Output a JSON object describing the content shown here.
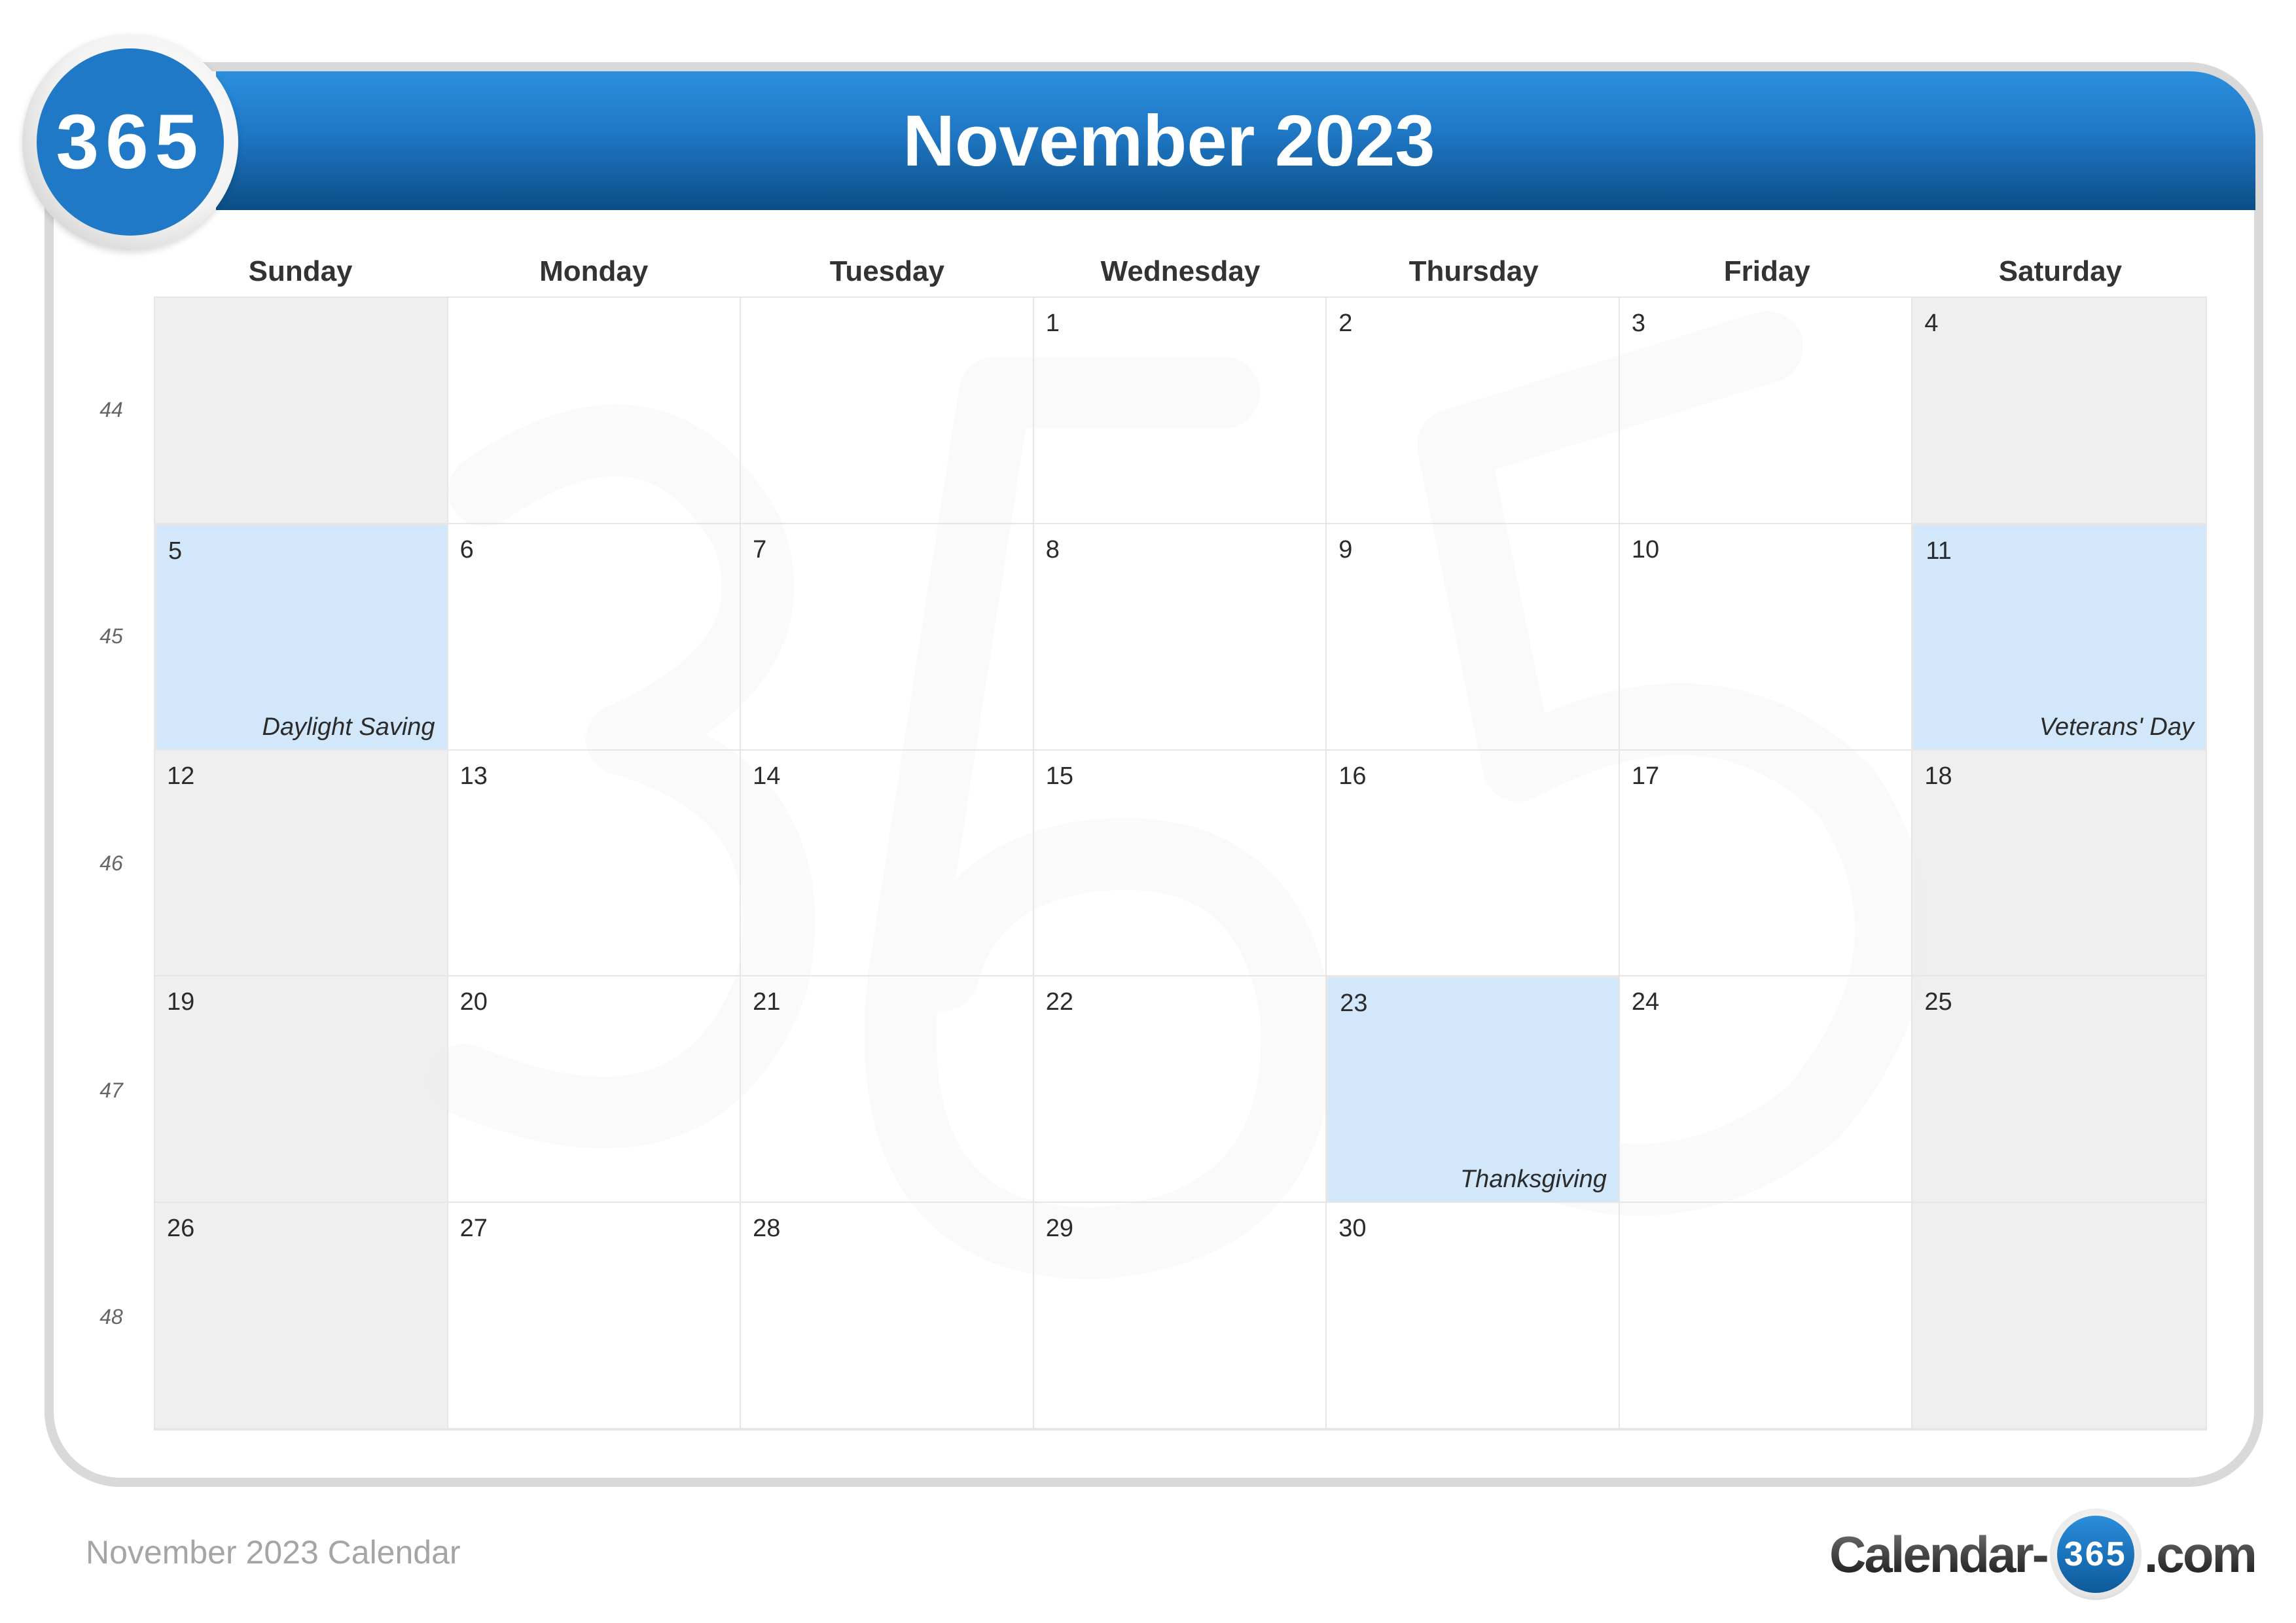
{
  "logo": {
    "text": "365"
  },
  "header": {
    "title": "November 2023"
  },
  "day_headers": [
    "Sunday",
    "Monday",
    "Tuesday",
    "Wednesday",
    "Thursday",
    "Friday",
    "Saturday"
  ],
  "week_numbers": [
    "44",
    "45",
    "46",
    "47",
    "48"
  ],
  "weeks": [
    [
      {
        "day": "",
        "weekend": true
      },
      {
        "day": ""
      },
      {
        "day": ""
      },
      {
        "day": "1"
      },
      {
        "day": "2"
      },
      {
        "day": "3"
      },
      {
        "day": "4",
        "weekend": true
      }
    ],
    [
      {
        "day": "5",
        "weekend": true,
        "holiday": true,
        "event": "Daylight Saving"
      },
      {
        "day": "6"
      },
      {
        "day": "7"
      },
      {
        "day": "8"
      },
      {
        "day": "9"
      },
      {
        "day": "10"
      },
      {
        "day": "11",
        "weekend": true,
        "holiday": true,
        "event": "Veterans' Day"
      }
    ],
    [
      {
        "day": "12",
        "weekend": true
      },
      {
        "day": "13"
      },
      {
        "day": "14"
      },
      {
        "day": "15"
      },
      {
        "day": "16"
      },
      {
        "day": "17"
      },
      {
        "day": "18",
        "weekend": true
      }
    ],
    [
      {
        "day": "19",
        "weekend": true
      },
      {
        "day": "20"
      },
      {
        "day": "21"
      },
      {
        "day": "22"
      },
      {
        "day": "23",
        "holiday": true,
        "event": "Thanksgiving"
      },
      {
        "day": "24"
      },
      {
        "day": "25",
        "weekend": true
      }
    ],
    [
      {
        "day": "26",
        "weekend": true
      },
      {
        "day": "27"
      },
      {
        "day": "28"
      },
      {
        "day": "29"
      },
      {
        "day": "30"
      },
      {
        "day": ""
      },
      {
        "day": "",
        "weekend": true
      }
    ]
  ],
  "footer": {
    "caption": "November 2023 Calendar",
    "brand_prefix": "Calendar-",
    "brand_circle": "365",
    "brand_suffix": ".com"
  },
  "colors": {
    "header_top": "#2b8fde",
    "header_bottom": "#0b4e86",
    "holiday_fill": "#d3e7fa",
    "weekend_fill": "#ececec"
  }
}
